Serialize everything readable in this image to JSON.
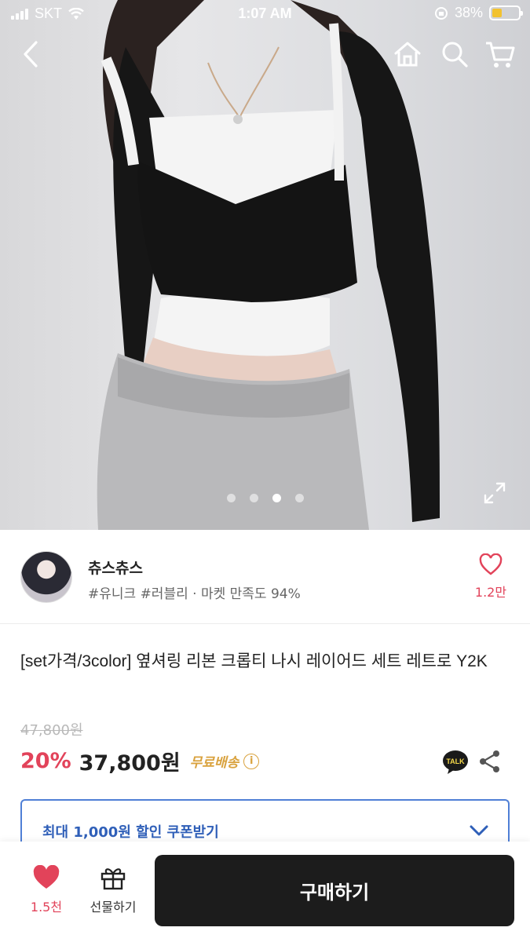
{
  "status_bar": {
    "carrier": "SKT",
    "time": "1:07 AM",
    "battery": "38%"
  },
  "gallery": {
    "total_images": 4,
    "current_index": 2
  },
  "seller": {
    "name": "츄스츄스",
    "meta": "#유니크 #러블리 · 마켓 만족도 94%",
    "like_count": "1.2만"
  },
  "product": {
    "title": "[set가격/3color] 옆셔링 리본 크롭티 나시 레이어드 세트 레트로 Y2K",
    "original_price": "47,800원",
    "discount": "20%",
    "price": "37,800원",
    "shipping": "무료배송",
    "talk_label": "TALK"
  },
  "coupon": {
    "label": "최대 1,000원 할인 쿠폰받기"
  },
  "bottom_bar": {
    "wish_count": "1.5천",
    "gift_label": "선물하기",
    "buy_label": "구매하기"
  },
  "colors": {
    "accent_red": "#e2435a",
    "coupon_blue": "#2f5fb8",
    "shipping_gold": "#d9a23e",
    "buy_button": "#1c1c1c"
  }
}
